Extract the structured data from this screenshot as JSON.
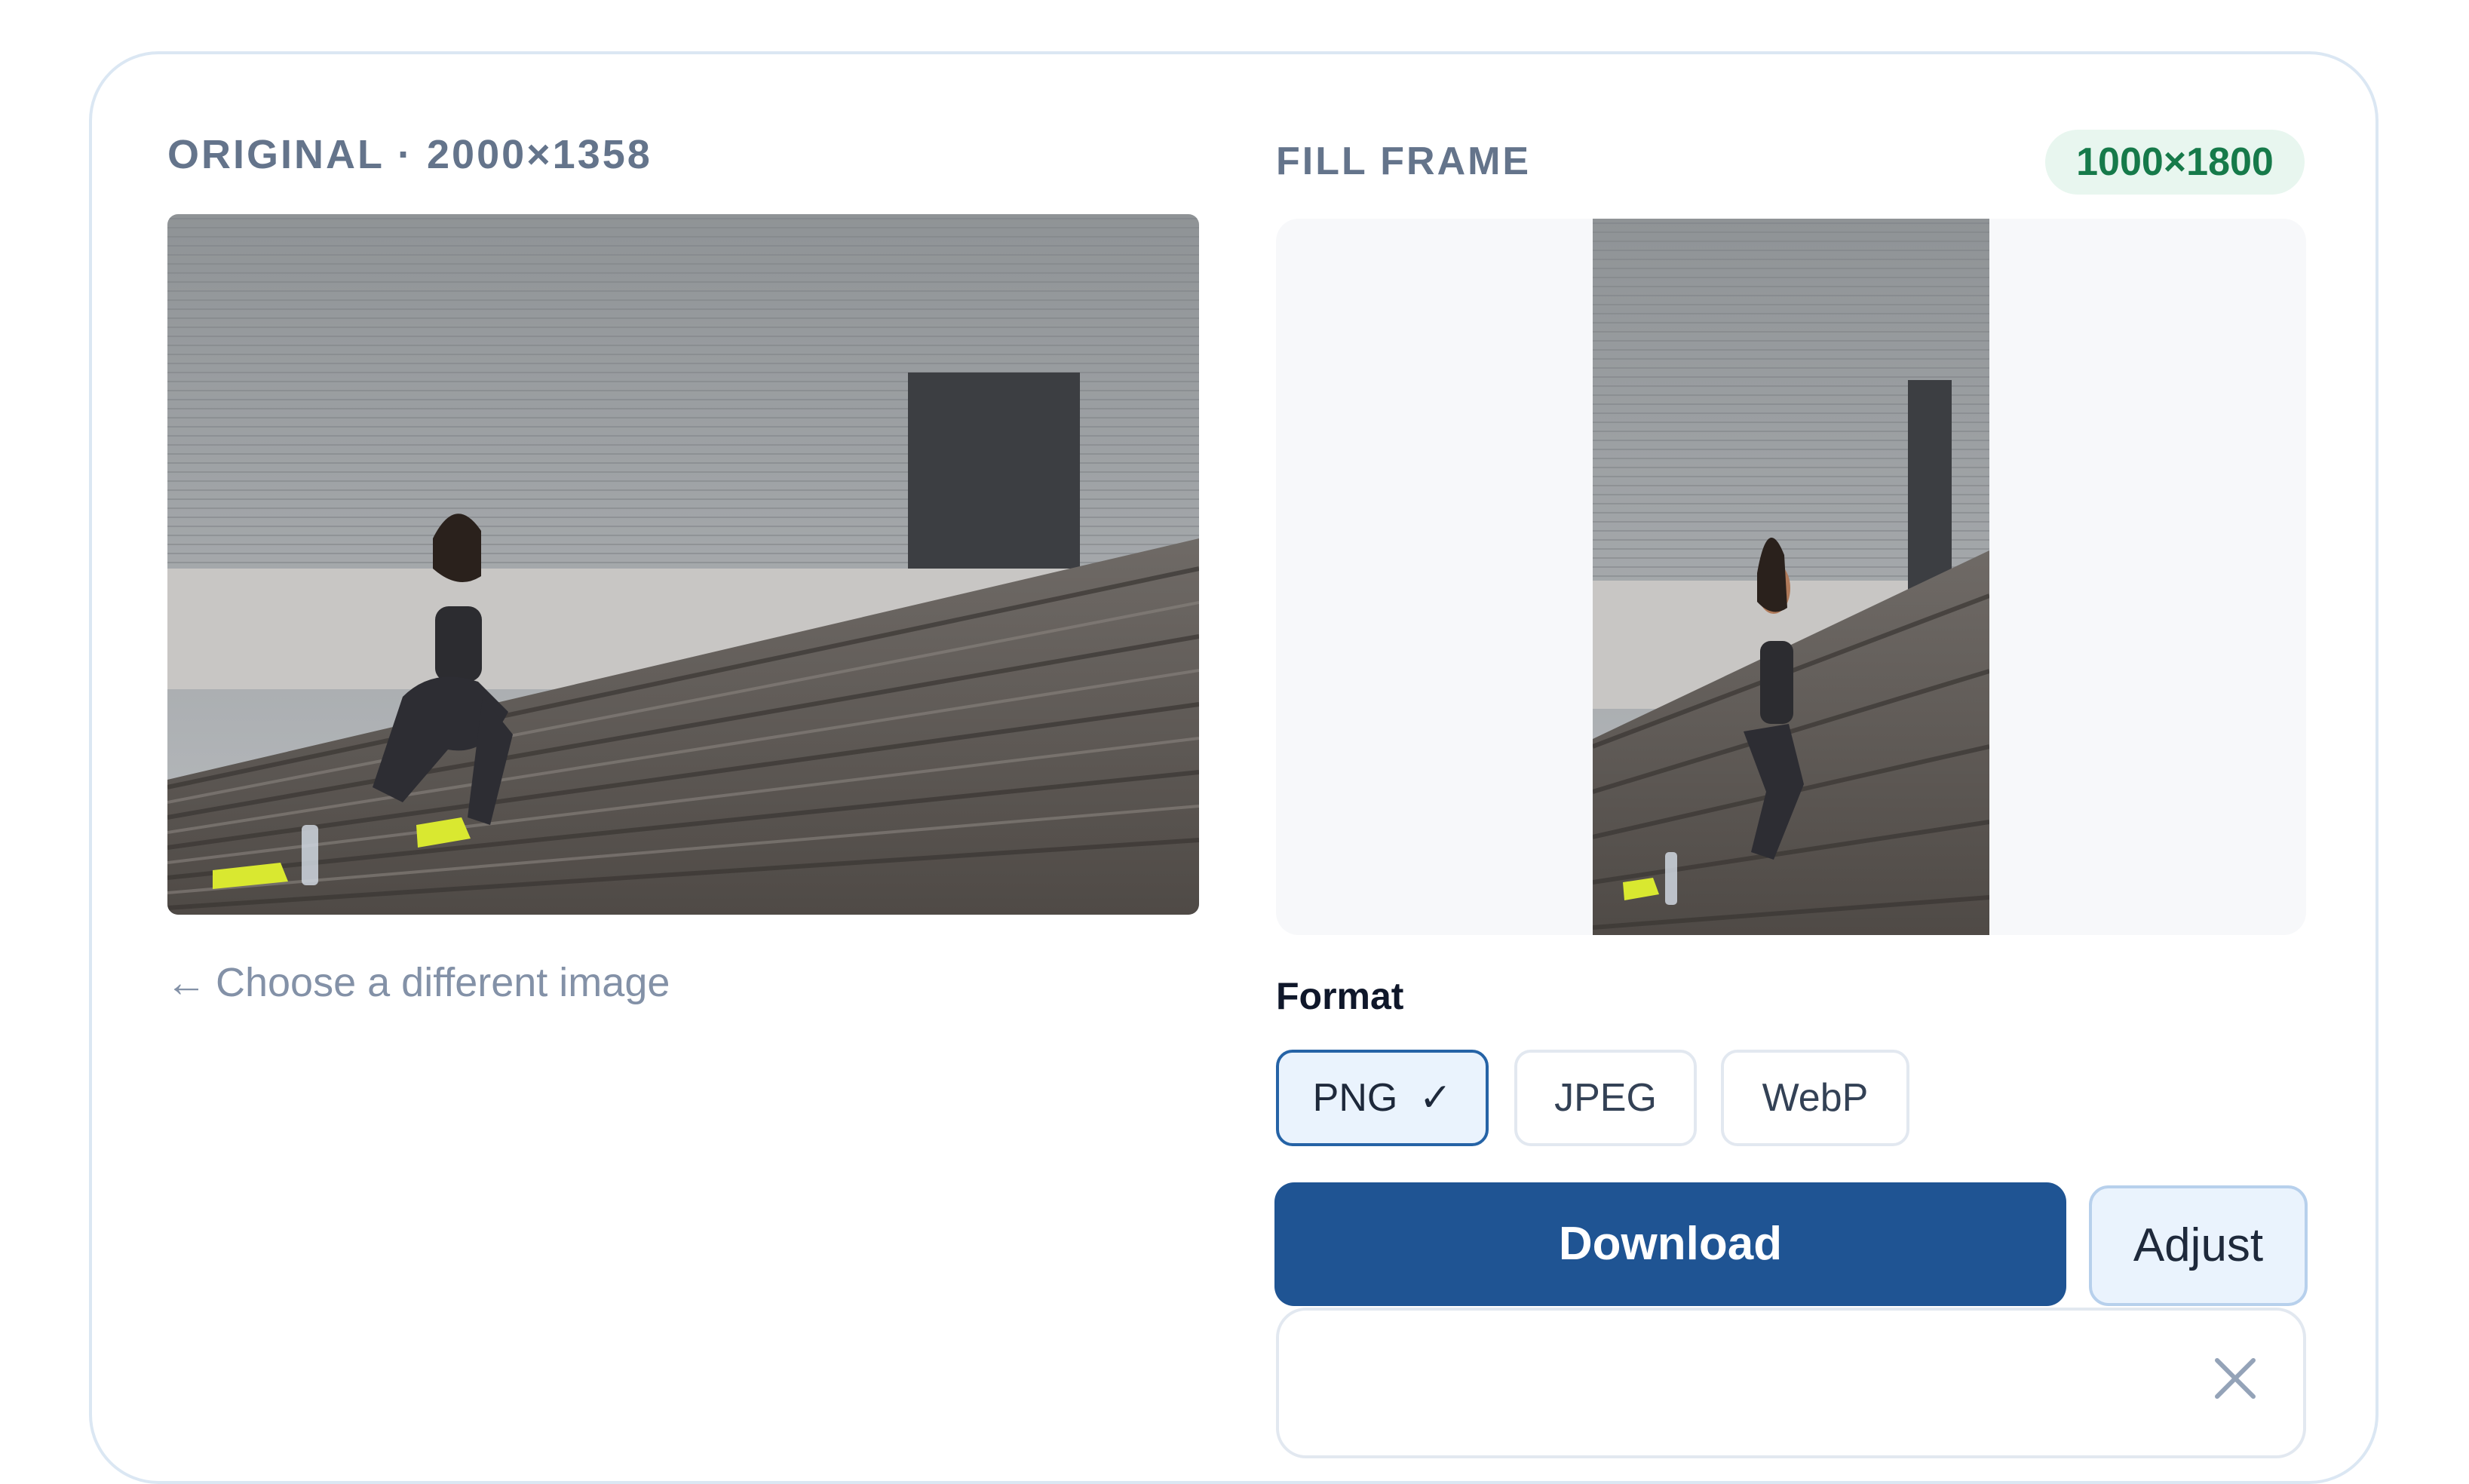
{
  "original": {
    "label": "ORIGINAL · 2000×1358",
    "back_link": {
      "arrow": "←",
      "text": "Choose a different image"
    }
  },
  "preview": {
    "label": "FILL FRAME",
    "dimensions": "1000×1800"
  },
  "format": {
    "label": "Format",
    "options": [
      {
        "label": "PNG",
        "selected": true,
        "check": "✓"
      },
      {
        "label": "JPEG",
        "selected": false
      },
      {
        "label": "WebP",
        "selected": false
      }
    ]
  },
  "actions": {
    "download_label": "Download",
    "adjust_label": "Adjust"
  },
  "colors": {
    "primary": "#1f5493",
    "badge_bg": "#e8f6ef",
    "badge_text": "#167a4a",
    "selected_border": "#2563a6"
  },
  "icons": {
    "back": "arrow-left-icon",
    "check": "check-icon",
    "close": "close-icon"
  }
}
